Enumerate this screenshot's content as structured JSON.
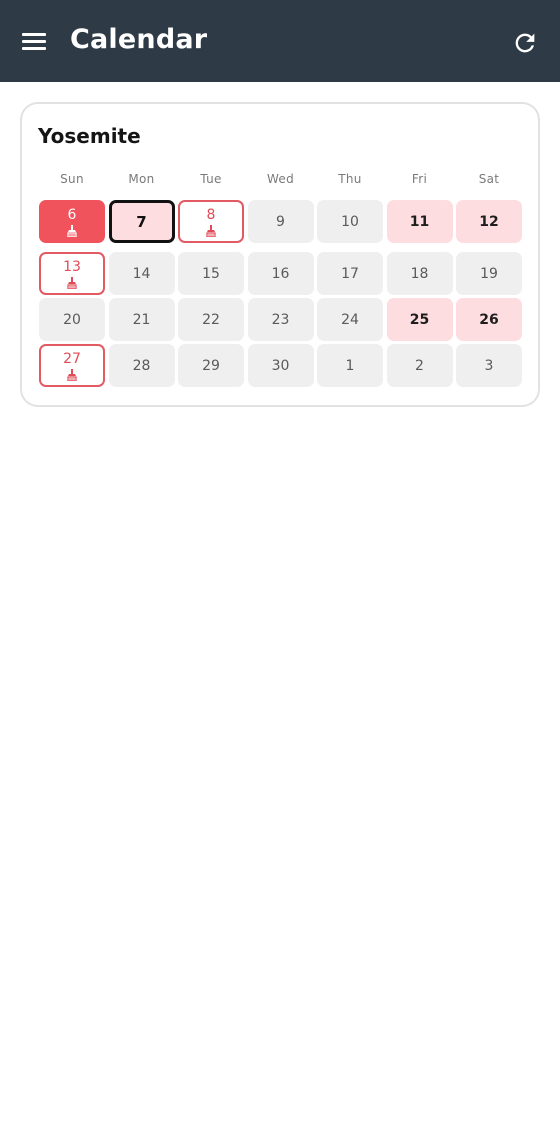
{
  "appbar": {
    "title": "Calendar",
    "menu_icon": "hamburger-menu-icon",
    "refresh_icon": "refresh-icon",
    "background_color": "#2e3a45"
  },
  "calendar": {
    "title": "Yosemite",
    "weekdays": [
      "Sun",
      "Mon",
      "Tue",
      "Wed",
      "Thu",
      "Fri",
      "Sat"
    ],
    "colors": {
      "filled": "#f0535c",
      "outline": "#e15a64",
      "highlight": "#fddde0",
      "default": "#efefef",
      "today_border": "#111111"
    },
    "days": [
      {
        "label": "6",
        "state": "filled",
        "icon": "brush-icon"
      },
      {
        "label": "7",
        "state": "today"
      },
      {
        "label": "8",
        "state": "outlined",
        "icon": "brush-icon"
      },
      {
        "label": "9",
        "state": "default"
      },
      {
        "label": "10",
        "state": "default"
      },
      {
        "label": "11",
        "state": "highlight"
      },
      {
        "label": "12",
        "state": "highlight"
      },
      {
        "label": "13",
        "state": "outlined",
        "icon": "brush-icon"
      },
      {
        "label": "14",
        "state": "default"
      },
      {
        "label": "15",
        "state": "default"
      },
      {
        "label": "16",
        "state": "default"
      },
      {
        "label": "17",
        "state": "default"
      },
      {
        "label": "18",
        "state": "default"
      },
      {
        "label": "19",
        "state": "default"
      },
      {
        "label": "20",
        "state": "default"
      },
      {
        "label": "21",
        "state": "default"
      },
      {
        "label": "22",
        "state": "default"
      },
      {
        "label": "23",
        "state": "default"
      },
      {
        "label": "24",
        "state": "default"
      },
      {
        "label": "25",
        "state": "highlight"
      },
      {
        "label": "26",
        "state": "highlight"
      },
      {
        "label": "27",
        "state": "outlined",
        "icon": "brush-icon"
      },
      {
        "label": "28",
        "state": "default"
      },
      {
        "label": "29",
        "state": "default"
      },
      {
        "label": "30",
        "state": "default"
      },
      {
        "label": "1",
        "state": "default"
      },
      {
        "label": "2",
        "state": "default"
      },
      {
        "label": "3",
        "state": "default"
      }
    ]
  }
}
